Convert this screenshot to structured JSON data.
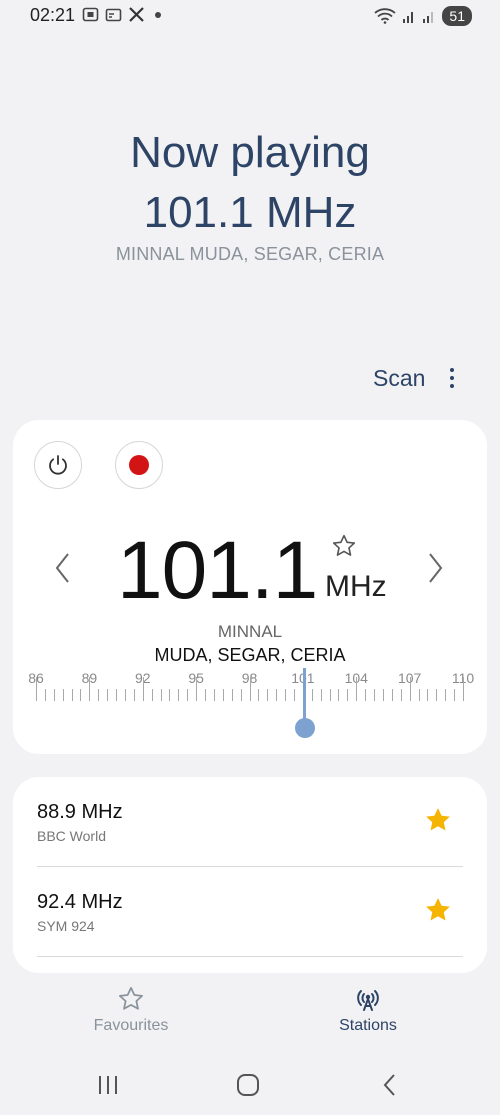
{
  "status_bar": {
    "time": "02:21",
    "battery": "51",
    "icons": [
      "screenshot-icon",
      "cast-icon",
      "x-app-icon",
      "notification-dot",
      "wifi-icon",
      "signal-icon",
      "signal-icon"
    ]
  },
  "now_playing": {
    "title": "Now playing",
    "frequency": "101.1 MHz",
    "station_text": "MINNAL MUDA, SEGAR, CERIA"
  },
  "toolbar": {
    "scan_label": "Scan",
    "more_icon": "more-vert-icon"
  },
  "tuner": {
    "frequency": "101.1",
    "unit": "MHz",
    "rds_line1": "MINNAL",
    "rds_line2": "MUDA, SEGAR, CERIA",
    "scale_min": 86,
    "scale_max": 110,
    "scale_labels": [
      "86",
      "89",
      "92",
      "95",
      "98",
      "101",
      "104",
      "107",
      "110"
    ],
    "current_value": 101.1,
    "power_icon": "power-icon",
    "record_icon": "record-icon",
    "favourite_icon": "star-outline-icon"
  },
  "stations": [
    {
      "frequency": "88.9 MHz",
      "name": "BBC World",
      "favourite": true
    },
    {
      "frequency": "92.4 MHz",
      "name": "SYM 924",
      "favourite": true
    }
  ],
  "bottom_tabs": {
    "favourites": "Favourites",
    "stations": "Stations"
  },
  "colors": {
    "accent": "#2d4466",
    "star": "#f4b400",
    "record": "#d31414",
    "needle": "#7da2d0"
  }
}
